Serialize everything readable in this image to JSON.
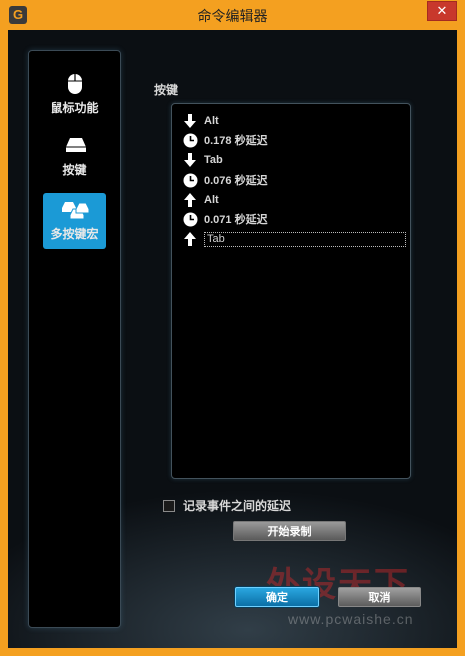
{
  "window": {
    "title": "命令编辑器",
    "app_logo": "G",
    "close_glyph": "✕",
    "frame_color": "#f4a020",
    "accent": "#1b9ad6"
  },
  "nav": {
    "items": [
      {
        "label": "鼠标功能",
        "icon": "mouse-icon"
      },
      {
        "label": "按键",
        "icon": "key-icon"
      },
      {
        "label": "多按键宏",
        "icon": "multi-key-icon",
        "active": true
      }
    ]
  },
  "macro": {
    "section_label": "按键",
    "events": [
      {
        "icon": "arrow-down-icon",
        "text": "Alt"
      },
      {
        "icon": "clock-icon",
        "text": "0.178 秒延迟"
      },
      {
        "icon": "arrow-down-icon",
        "text": "Tab"
      },
      {
        "icon": "clock-icon",
        "text": "0.076 秒延迟"
      },
      {
        "icon": "arrow-up-icon",
        "text": "Alt"
      },
      {
        "icon": "clock-icon",
        "text": "0.071 秒延迟"
      },
      {
        "icon": "arrow-up-icon",
        "text": "Tab",
        "selected": true
      }
    ],
    "record_delays_label": "记录事件之间的延迟",
    "record_delays_checked": false,
    "start_record_label": "开始录制"
  },
  "footer": {
    "ok_label": "确定",
    "cancel_label": "取消"
  },
  "watermark": {
    "big": "外设天下",
    "small": "www.pcwaishe.cn"
  }
}
